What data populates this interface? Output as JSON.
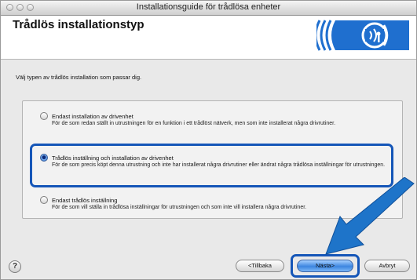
{
  "window": {
    "title": "Installationsguide för trådlösa enheter"
  },
  "header": {
    "title": "Trådlös installationstyp"
  },
  "instruction": "Välj typen av trådlös installation som passar dig.",
  "options": [
    {
      "label": "Endast installation av drivenhet",
      "description": "För de som redan ställt in utrustningen för en funktion i ett trådlöst nätverk, men som inte installerat några drivrutiner.",
      "selected": false
    },
    {
      "label": "Trådlös inställning och installation av drivenhet",
      "description": "För de som precis köpt denna utrustning och inte har installerat några drivrutiner eller ändrat några trådlösa inställningar för utrustningen.",
      "selected": true
    },
    {
      "label": "Endast trådlös inställning",
      "description": "För de som vill ställa in trådlösa inställningar för utrustningen och som inte vill installera några drivrutiner.",
      "selected": false
    }
  ],
  "footer": {
    "help_label": "?",
    "back_label": "<Tillbaka",
    "next_label": "Nästa>",
    "cancel_label": "Avbryt"
  },
  "colors": {
    "highlight": "#1556b8",
    "arrow": "#1e74c9"
  },
  "icons": {
    "logo": "wireless-logo-icon",
    "arrow": "pointer-arrow-icon"
  }
}
